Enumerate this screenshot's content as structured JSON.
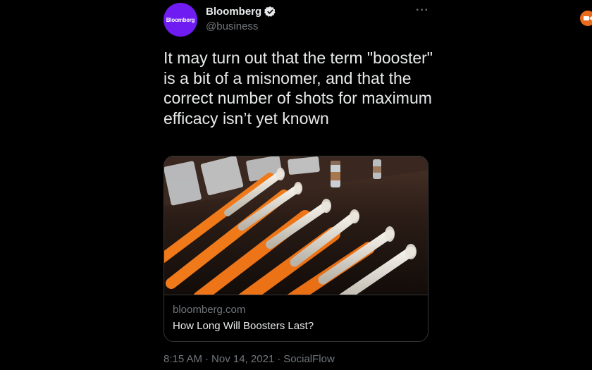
{
  "tweet": {
    "avatar_text": "Bloomberg",
    "display_name": "Bloomberg",
    "handle": "@business",
    "text": "It may turn out that the term \"booster\" is a bit of a misnomer, and that the correct number of shots for maximum efficacy isn’t yet known",
    "card": {
      "domain": "bloomberg.com",
      "title": "How Long Will Boosters Last?"
    },
    "time": "8:15 AM",
    "date": "Nov 14, 2021",
    "source": "SocialFlow",
    "separator": "·"
  },
  "icons": {
    "verified": "verified-badge-icon",
    "more": "more-options-icon",
    "corner": "video-camera-icon"
  },
  "colors": {
    "background": "#000000",
    "text": "#e7e9ea",
    "muted": "#71767b",
    "avatar": "#6f1cf2",
    "border": "#333639",
    "corner_icon": "#e86a1d"
  }
}
